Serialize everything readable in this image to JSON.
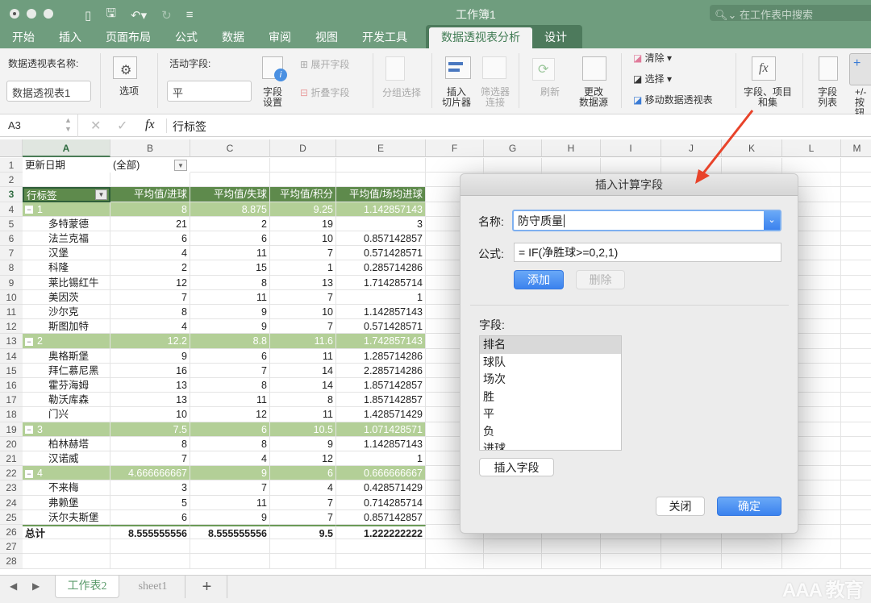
{
  "window": {
    "title": "工作簿1",
    "search_placeholder": "在工作表中搜索"
  },
  "ribbon_tabs": [
    {
      "label": "开始"
    },
    {
      "label": "插入"
    },
    {
      "label": "页面布局"
    },
    {
      "label": "公式"
    },
    {
      "label": "数据"
    },
    {
      "label": "审阅"
    },
    {
      "label": "视图"
    },
    {
      "label": "开发工具"
    },
    {
      "label": "数据透视表分析",
      "active": true
    },
    {
      "label": "设计"
    }
  ],
  "ribbon": {
    "pivot_name_label": "数据透视表名称:",
    "pivot_name_value": "数据透视表1",
    "options": "选项",
    "active_field_label": "活动字段:",
    "active_field_value": "平",
    "field_settings": "字段\n设置",
    "field_settings_l1": "字段",
    "field_settings_l2": "设置",
    "expand_field": "展开字段",
    "collapse_field": "折叠字段",
    "group_selection": "分组选择",
    "insert_slicer_l1": "插入",
    "insert_slicer_l2": "切片器",
    "filter_conn_l1": "筛选器",
    "filter_conn_l2": "连接",
    "refresh": "刷新",
    "change_source_l1": "更改",
    "change_source_l2": "数据源",
    "clear": "清除",
    "select": "选择",
    "move_pivot": "移动数据透视表",
    "fields_items_l1": "字段、项目",
    "fields_items_l2": "和集",
    "field_list_l1": "字段",
    "field_list_l2": "列表",
    "plusminus_l1": "+/-",
    "plusminus_l2": "按钮"
  },
  "formula_bar": {
    "name_box": "A3",
    "fx": "fx",
    "content": "行标签"
  },
  "columns": [
    "A",
    "B",
    "C",
    "D",
    "E",
    "F",
    "G",
    "H",
    "I",
    "J",
    "K",
    "L",
    "M"
  ],
  "sheet": {
    "row1": {
      "a": "更新日期",
      "b": "(全部)"
    },
    "header": [
      "行标签",
      "平均值/进球",
      "平均值/失球",
      "平均值/积分",
      "平均值/场均进球"
    ],
    "rows": [
      {
        "n": "4",
        "type": "group",
        "label": "1",
        "v": [
          "8",
          "8.875",
          "9.25",
          "1.142857143"
        ]
      },
      {
        "n": "5",
        "type": "item",
        "label": "多特蒙德",
        "v": [
          "21",
          "2",
          "19",
          "3"
        ]
      },
      {
        "n": "6",
        "type": "item",
        "label": "法兰克福",
        "v": [
          "6",
          "6",
          "10",
          "0.857142857"
        ]
      },
      {
        "n": "7",
        "type": "item",
        "label": "汉堡",
        "v": [
          "4",
          "11",
          "7",
          "0.571428571"
        ]
      },
      {
        "n": "8",
        "type": "item",
        "label": "科隆",
        "v": [
          "2",
          "15",
          "1",
          "0.285714286"
        ]
      },
      {
        "n": "9",
        "type": "item",
        "label": "莱比锡红牛",
        "v": [
          "12",
          "8",
          "13",
          "1.714285714"
        ]
      },
      {
        "n": "10",
        "type": "item",
        "label": "美因茨",
        "v": [
          "7",
          "11",
          "7",
          "1"
        ]
      },
      {
        "n": "11",
        "type": "item",
        "label": "沙尔克",
        "v": [
          "8",
          "9",
          "10",
          "1.142857143"
        ]
      },
      {
        "n": "12",
        "type": "item",
        "label": "斯图加特",
        "v": [
          "4",
          "9",
          "7",
          "0.571428571"
        ]
      },
      {
        "n": "13",
        "type": "group",
        "label": "2",
        "v": [
          "12.2",
          "8.8",
          "11.6",
          "1.742857143"
        ]
      },
      {
        "n": "14",
        "type": "item",
        "label": "奥格斯堡",
        "v": [
          "9",
          "6",
          "11",
          "1.285714286"
        ]
      },
      {
        "n": "15",
        "type": "item",
        "label": "拜仁慕尼黑",
        "v": [
          "16",
          "7",
          "14",
          "2.285714286"
        ]
      },
      {
        "n": "16",
        "type": "item",
        "label": "霍芬海姆",
        "v": [
          "13",
          "8",
          "14",
          "1.857142857"
        ]
      },
      {
        "n": "17",
        "type": "item",
        "label": "勒沃库森",
        "v": [
          "13",
          "11",
          "8",
          "1.857142857"
        ]
      },
      {
        "n": "18",
        "type": "item",
        "label": "门兴",
        "v": [
          "10",
          "12",
          "11",
          "1.428571429"
        ]
      },
      {
        "n": "19",
        "type": "group",
        "label": "3",
        "v": [
          "7.5",
          "6",
          "10.5",
          "1.071428571"
        ]
      },
      {
        "n": "20",
        "type": "item",
        "label": "柏林赫塔",
        "v": [
          "8",
          "8",
          "9",
          "1.142857143"
        ]
      },
      {
        "n": "21",
        "type": "item",
        "label": "汉诺威",
        "v": [
          "7",
          "4",
          "12",
          "1"
        ]
      },
      {
        "n": "22",
        "type": "group",
        "label": "4",
        "v": [
          "4.666666667",
          "9",
          "6",
          "0.666666667"
        ]
      },
      {
        "n": "23",
        "type": "item",
        "label": "不来梅",
        "v": [
          "3",
          "7",
          "4",
          "0.428571429"
        ]
      },
      {
        "n": "24",
        "type": "item",
        "label": "弗赖堡",
        "v": [
          "5",
          "11",
          "7",
          "0.714285714"
        ]
      },
      {
        "n": "25",
        "type": "item",
        "label": "沃尔夫斯堡",
        "v": [
          "6",
          "9",
          "7",
          "0.857142857"
        ]
      },
      {
        "n": "26",
        "type": "total",
        "label": "总计",
        "v": [
          "8.555555556",
          "8.555555556",
          "9.5",
          "1.222222222"
        ]
      }
    ]
  },
  "sheet_tabs": [
    {
      "label": "工作表2",
      "active": true
    },
    {
      "label": "sheet1"
    }
  ],
  "add_sheet": "+",
  "dialog": {
    "title": "插入计算字段",
    "name_label": "名称:",
    "name_value": "防守质量",
    "formula_label": "公式:",
    "formula_value": "= IF(净胜球>=0,2,1)",
    "add_button": "添加",
    "delete_button": "删除",
    "fields_label": "字段:",
    "fields": [
      "排名",
      "球队",
      "场次",
      "胜",
      "平",
      "负",
      "进球"
    ],
    "selected_field": "排名",
    "insert_field_button": "插入字段",
    "close_button": "关闭",
    "ok_button": "确定"
  },
  "watermark": "AAA 教育",
  "colors": {
    "titlebar": "#6f9d7e",
    "pivot_header": "#5e8a4c",
    "pivot_group": "#b3cf97",
    "primary_button": "#3b82ee",
    "annotation_arrow": "#e8432a"
  }
}
